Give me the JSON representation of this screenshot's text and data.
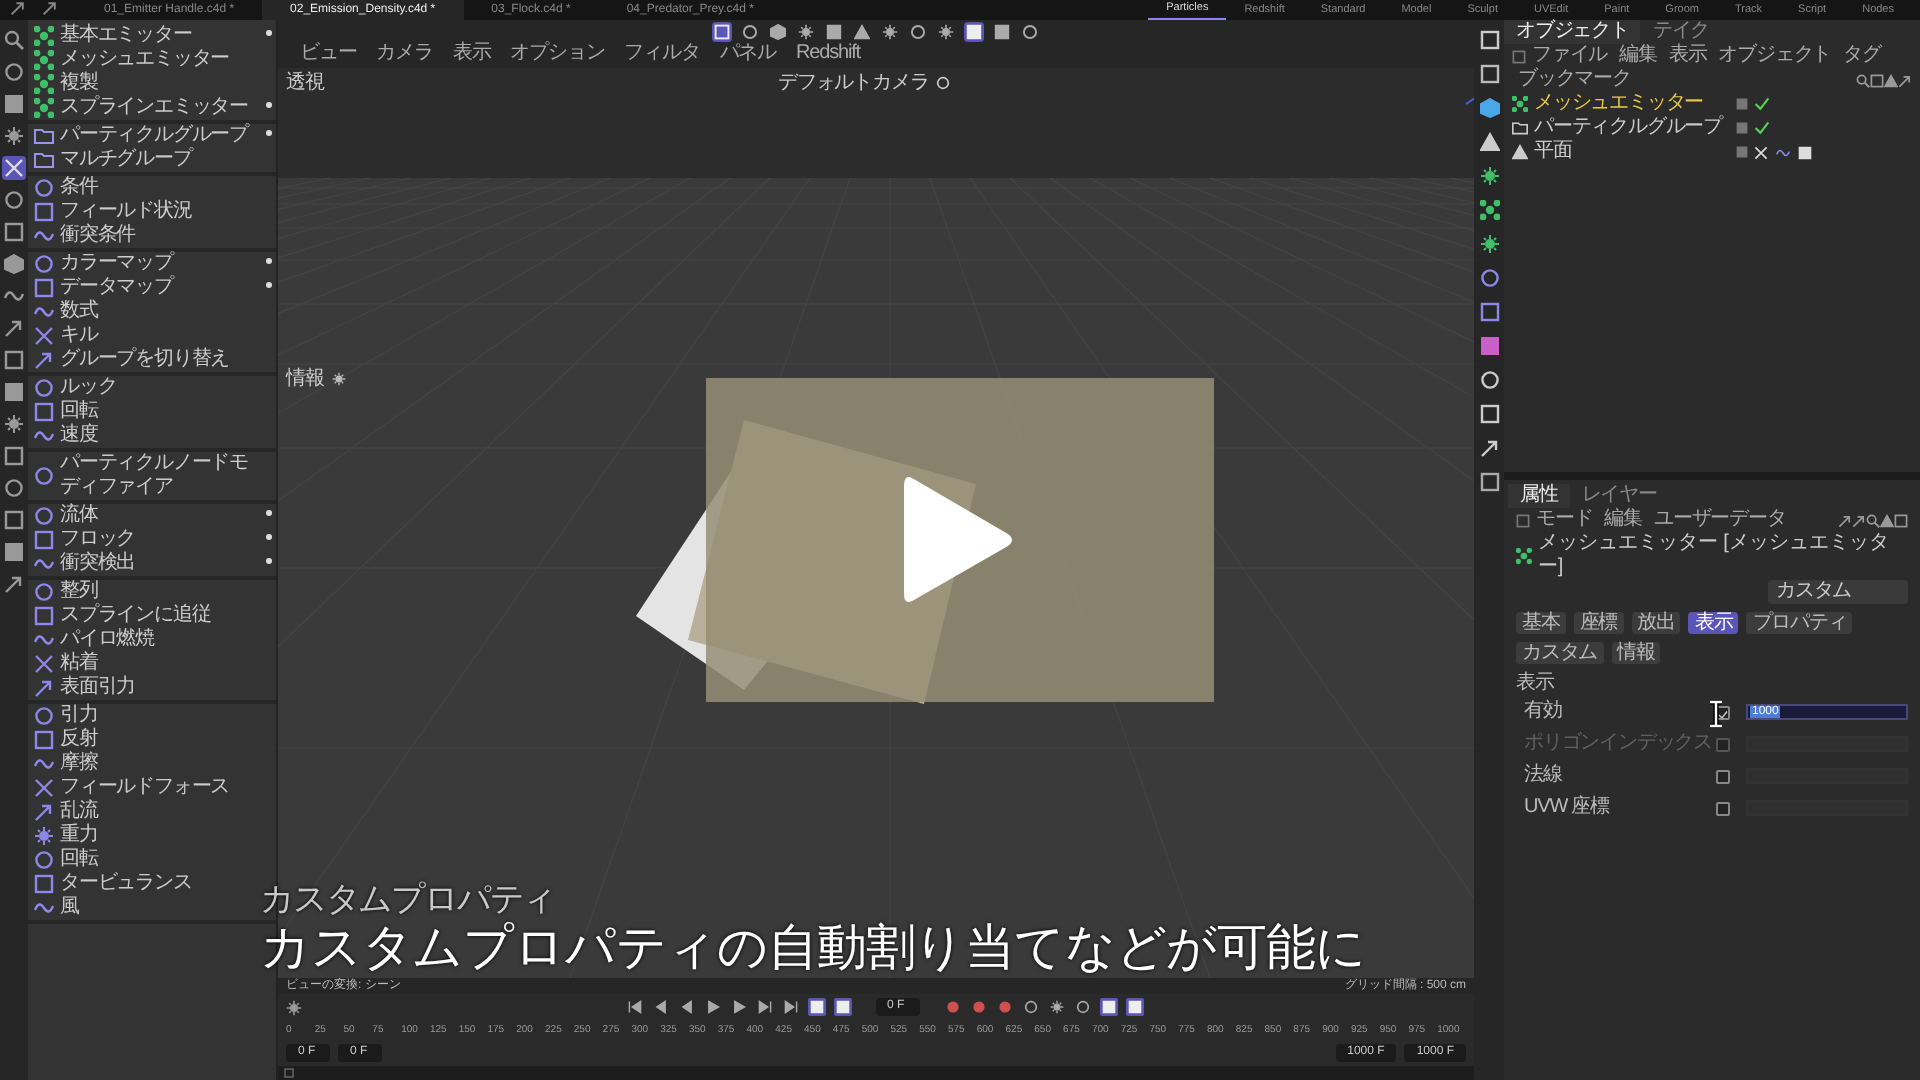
{
  "file_tabs": [
    {
      "label": "01_Emitter Handle.c4d *",
      "selected": false
    },
    {
      "label": "02_Emission_Density.c4d *",
      "selected": true
    },
    {
      "label": "03_Flock.c4d *",
      "selected": false
    },
    {
      "label": "04_Predator_Prey.c4d *",
      "selected": false
    }
  ],
  "layouts": [
    {
      "label": "Particles",
      "selected": true
    },
    {
      "label": "Redshift",
      "selected": false
    },
    {
      "label": "Standard",
      "selected": false
    },
    {
      "label": "Model",
      "selected": false
    },
    {
      "label": "Sculpt",
      "selected": false
    },
    {
      "label": "UVEdit",
      "selected": false
    },
    {
      "label": "Paint",
      "selected": false
    },
    {
      "label": "Groom",
      "selected": false
    },
    {
      "label": "Track",
      "selected": false
    },
    {
      "label": "Script",
      "selected": false
    },
    {
      "label": "Nodes",
      "selected": false
    }
  ],
  "left_tools": [
    {
      "selected": false
    },
    {
      "selected": false
    },
    {
      "selected": false
    },
    {
      "selected": false
    },
    {
      "selected": true
    },
    {
      "selected": false
    },
    {
      "selected": false
    },
    {
      "selected": false
    },
    {
      "selected": false
    },
    {
      "selected": false
    },
    {
      "selected": false
    },
    {
      "selected": false
    },
    {
      "selected": false
    },
    {
      "selected": false
    },
    {
      "selected": false
    },
    {
      "selected": false
    },
    {
      "selected": false
    },
    {
      "selected": false
    }
  ],
  "menu": {
    "groups": [
      {
        "kind": "emitter",
        "items": [
          {
            "label": "基本エミッター",
            "submenu": true
          },
          {
            "label": "メッシュエミッター",
            "submenu": false
          },
          {
            "label": "複製",
            "submenu": false
          },
          {
            "label": "スプラインエミッター",
            "submenu": true
          }
        ]
      },
      {
        "kind": "group",
        "items": [
          {
            "label": "パーティクルグループ",
            "submenu": true
          },
          {
            "label": "マルチグループ",
            "submenu": false
          }
        ]
      },
      {
        "kind": "modifier",
        "items": [
          {
            "label": "条件",
            "submenu": false
          },
          {
            "label": "フィールド状況",
            "submenu": false
          },
          {
            "label": "衝突条件",
            "submenu": false
          }
        ]
      },
      {
        "kind": "modifier",
        "items": [
          {
            "label": "カラーマップ",
            "submenu": true
          },
          {
            "label": "データマップ",
            "submenu": true
          },
          {
            "label": "数式",
            "submenu": false
          },
          {
            "label": "キル",
            "submenu": false
          },
          {
            "label": "グループを切り替え",
            "submenu": false
          }
        ]
      },
      {
        "kind": "modifier",
        "items": [
          {
            "label": "ルック",
            "submenu": false
          },
          {
            "label": "回転",
            "submenu": false
          },
          {
            "label": "速度",
            "submenu": false
          }
        ]
      },
      {
        "kind": "modifier",
        "items": [
          {
            "label": "パーティクルノードモディファイア",
            "submenu": false
          }
        ]
      },
      {
        "kind": "modifier",
        "items": [
          {
            "label": "流体",
            "submenu": true
          },
          {
            "label": "フロック",
            "submenu": true
          },
          {
            "label": "衝突検出",
            "submenu": true
          }
        ]
      },
      {
        "kind": "modifier",
        "items": [
          {
            "label": "整列",
            "submenu": false
          },
          {
            "label": "スプラインに追従",
            "submenu": false
          },
          {
            "label": "パイロ燃焼",
            "submenu": false
          },
          {
            "label": "粘着",
            "submenu": false
          },
          {
            "label": "表面引力",
            "submenu": false
          }
        ]
      },
      {
        "kind": "modifier",
        "items": [
          {
            "label": "引力",
            "submenu": false
          },
          {
            "label": "反射",
            "submenu": false
          },
          {
            "label": "摩擦",
            "submenu": false
          },
          {
            "label": "フィールドフォース",
            "submenu": false
          },
          {
            "label": "乱流",
            "submenu": false
          },
          {
            "label": "重力",
            "submenu": false
          },
          {
            "label": "回転",
            "submenu": false
          },
          {
            "label": "タービュランス",
            "submenu": false
          },
          {
            "label": "風",
            "submenu": false
          }
        ]
      }
    ]
  },
  "viewport": {
    "toolbar_buttons": [
      {
        "selected": true
      },
      {
        "selected": false
      },
      {
        "selected": false
      },
      {
        "selected": false
      },
      {
        "selected": false
      },
      {
        "selected": false
      },
      {
        "selected": false
      },
      {
        "selected": false
      },
      {
        "selected": false
      },
      {
        "selected": true
      },
      {
        "selected": false
      },
      {
        "selected": false
      }
    ],
    "menu": [
      "ビュー",
      "カメラ",
      "表示",
      "オプション",
      "フィルタ",
      "パネル",
      "Redshift"
    ],
    "view_name": "透視",
    "camera": "デフォルトカメラ",
    "hud_label": "情報",
    "status_left": "ビューの変換: シーン",
    "status_right": "グリッド間隔 : 500 cm"
  },
  "timeline": {
    "transport": [
      {
        "selected": false
      },
      {
        "selected": false
      },
      {
        "selected": false
      },
      {
        "selected": false
      },
      {
        "selected": false
      },
      {
        "selected": false
      },
      {
        "selected": false
      },
      {
        "selected": true
      },
      {
        "selected": true
      }
    ],
    "current_frame": "0 F",
    "keys": [
      {
        "selected": false
      },
      {
        "selected": false
      },
      {
        "selected": false
      },
      {
        "selected": false
      },
      {
        "selected": false
      },
      {
        "selected": false
      },
      {
        "selected": true
      },
      {
        "selected": true
      }
    ],
    "ticks": [
      "0",
      "25",
      "50",
      "75",
      "100",
      "125",
      "150",
      "175",
      "200",
      "225",
      "250",
      "275",
      "300",
      "325",
      "350",
      "375",
      "400",
      "425",
      "450",
      "475",
      "500",
      "525",
      "550",
      "575",
      "600",
      "625",
      "650",
      "675",
      "700",
      "725",
      "750",
      "775",
      "800",
      "825",
      "850",
      "875",
      "900",
      "925",
      "950",
      "975",
      "1000"
    ],
    "start": "0 F",
    "preview_start": "0 F",
    "preview_end": "1000 F",
    "end": "1000 F"
  },
  "object_manager": {
    "tabs": [
      {
        "label": "オブジェクト",
        "selected": true
      },
      {
        "label": "テイク",
        "selected": false
      }
    ],
    "menu": [
      "ファイル",
      "編集",
      "表示",
      "オブジェクト",
      "タグ",
      "ブックマーク"
    ],
    "objects": [
      {
        "label": "メッシュエミッター",
        "kind": "emitter",
        "selected": true,
        "check": true,
        "tags": false
      },
      {
        "label": "パーティクルグループ",
        "kind": "group",
        "selected": false,
        "check": true,
        "tags": false
      },
      {
        "label": "平面",
        "kind": "plane",
        "selected": false,
        "check": false,
        "tags": true
      }
    ]
  },
  "attributes": {
    "tabs": [
      {
        "label": "属性",
        "selected": true
      },
      {
        "label": "レイヤー",
        "selected": false
      }
    ],
    "menu": [
      "モード",
      "編集",
      "ユーザーデータ"
    ],
    "object_title": "メッシュエミッター [メッシュエミッター]",
    "preset": "カスタム",
    "pages": [
      {
        "label": "基本",
        "selected": false
      },
      {
        "label": "座標",
        "selected": false
      },
      {
        "label": "放出",
        "selected": false
      },
      {
        "label": "表示",
        "selected": true
      },
      {
        "label": "プロパティ",
        "selected": false
      },
      {
        "label": "カスタム",
        "selected": false
      },
      {
        "label": "情報",
        "selected": false
      }
    ],
    "section": "表示",
    "rows": [
      {
        "label": "有効",
        "checked": true,
        "disabled": false,
        "value": "1000"
      },
      {
        "label": "ポリゴンインデックス",
        "checked": false,
        "disabled": true
      },
      {
        "label": "法線",
        "checked": false,
        "disabled": false
      },
      {
        "label": "UVW 座標",
        "checked": false,
        "disabled": false
      }
    ]
  },
  "subtitle": {
    "heading": "カスタムプロパティ",
    "text": "カスタムプロパティの自動割り当てなどが可能に"
  }
}
